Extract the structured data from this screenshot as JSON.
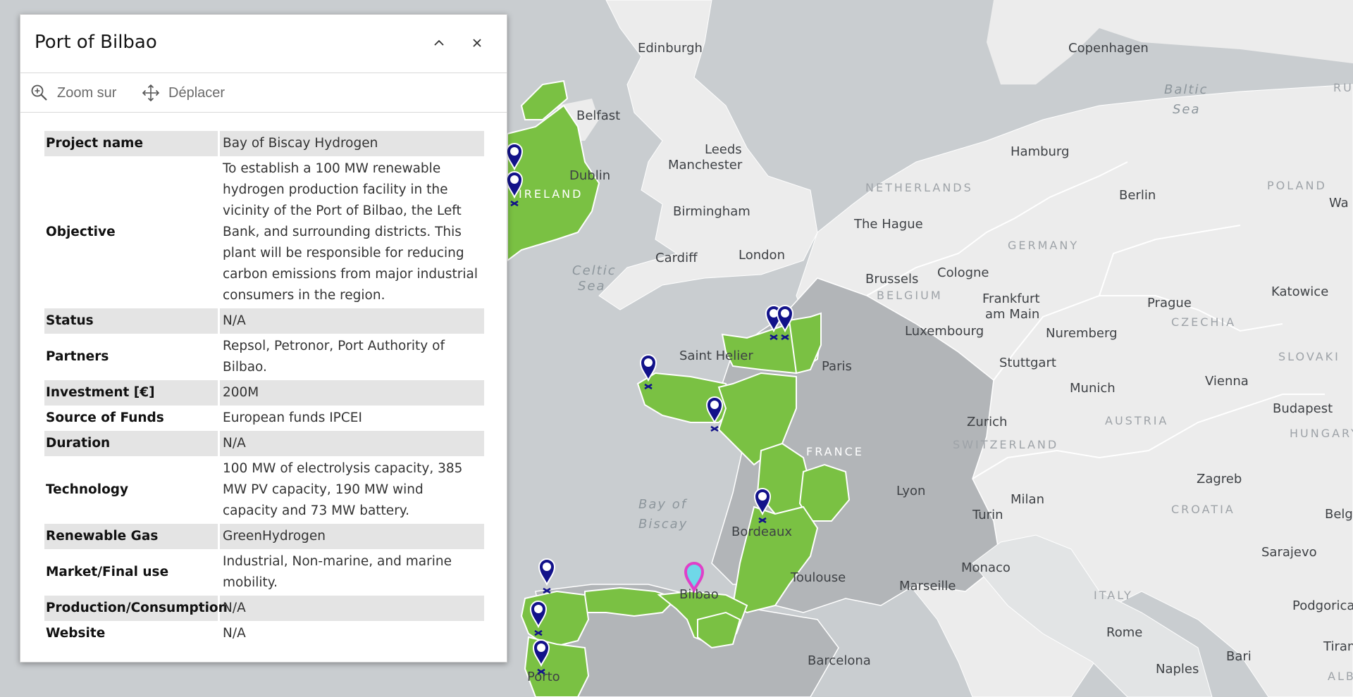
{
  "popup": {
    "title": "Port of Bilbao",
    "tools": {
      "zoom": "Zoom sur",
      "move": "Déplacer"
    },
    "rows": [
      {
        "key": "Project name",
        "value": "Bay of Biscay Hydrogen"
      },
      {
        "key": "Objective",
        "value": "To establish a 100 MW renewable hydrogen production facility in the vicinity of the Port of Bilbao, the Left Bank, and surrounding districts. This plant will be responsible for reducing carbon emissions from major industrial consumers in the region."
      },
      {
        "key": "Status",
        "value": "N/A"
      },
      {
        "key": "Partners",
        "value": "Repsol, Petronor, Port Authority of Bilbao."
      },
      {
        "key": "Investment [€]",
        "value": "200M"
      },
      {
        "key": "Source of Funds",
        "value": "European funds IPCEI"
      },
      {
        "key": "Duration",
        "value": "N/A"
      },
      {
        "key": "Technology",
        "value": "100 MW of electrolysis capacity, 385 MW PV capacity, 190 MW wind capacity and 73 MW battery."
      },
      {
        "key": "Renewable Gas",
        "value": "GreenHydrogen"
      },
      {
        "key": "Market/Final use",
        "value": "Industrial, Non-marine, and marine mobility."
      },
      {
        "key": "Production/Consumption",
        "value": "N/A"
      },
      {
        "key": "Website",
        "value": "N/A"
      }
    ]
  },
  "map": {
    "colors": {
      "sea": "#c9cdd0",
      "land": "#ececec",
      "france": "#b2b5b8",
      "highlight": "#7ac143",
      "marker": "#12128a",
      "selected": "#e040c8"
    },
    "cities": {
      "edinburgh": "Edinburgh",
      "belfast": "Belfast",
      "dublin": "Dublin",
      "leeds": "Leeds",
      "manchester": "Manchester",
      "birmingham": "Birmingham",
      "cardiff": "Cardiff",
      "london": "London",
      "copenhagen": "Copenhagen",
      "hamburg": "Hamburg",
      "berlin": "Berlin",
      "the_hague": "The Hague",
      "brussels": "Brussels",
      "cologne": "Cologne",
      "frankfurt": "Frankfurt am Main",
      "luxembourg": "Luxembourg",
      "nuremberg": "Nuremberg",
      "prague": "Prague",
      "katowice": "Katowice",
      "paris": "Paris",
      "saint_helier": "Saint Helier",
      "stuttgart": "Stuttgart",
      "munich": "Munich",
      "vienna": "Vienna",
      "budapest": "Budapest",
      "zurich": "Zurich",
      "lyon": "Lyon",
      "milan": "Milan",
      "turin": "Turin",
      "zagreb": "Zagreb",
      "bordeaux": "Bordeaux",
      "toulouse": "Toulouse",
      "monaco": "Monaco",
      "marseille": "Marseille",
      "bilbao": "Bilbao",
      "barcelona": "Barcelona",
      "rome": "Rome",
      "naples": "Naples",
      "bari": "Bari",
      "sarajevo": "Sarajevo",
      "podgorica": "Podgorica",
      "tirana": "Tirana",
      "belg": "Belg",
      "wa": "Wa",
      "porto": "Porto"
    },
    "countries": {
      "ireland": "IRELAND",
      "netherlands": "NETHERLANDS",
      "germany": "GERMANY",
      "poland": "POLAND",
      "belgium": "BELGIUM",
      "czechia": "CZECHIA",
      "slovakia": "SLOVAKI",
      "austria": "AUSTRIA",
      "hungary": "HUNGARY",
      "switzerland": "SWITZERLAND",
      "france": "FRANCE",
      "croatia": "CROATIA",
      "italy": "ITALY",
      "albania": "ALBA",
      "ru": "RU"
    },
    "seas": {
      "baltic": "Baltic Sea",
      "celtic": "Celtic Sea",
      "biscay": "Bay of Biscay"
    }
  }
}
